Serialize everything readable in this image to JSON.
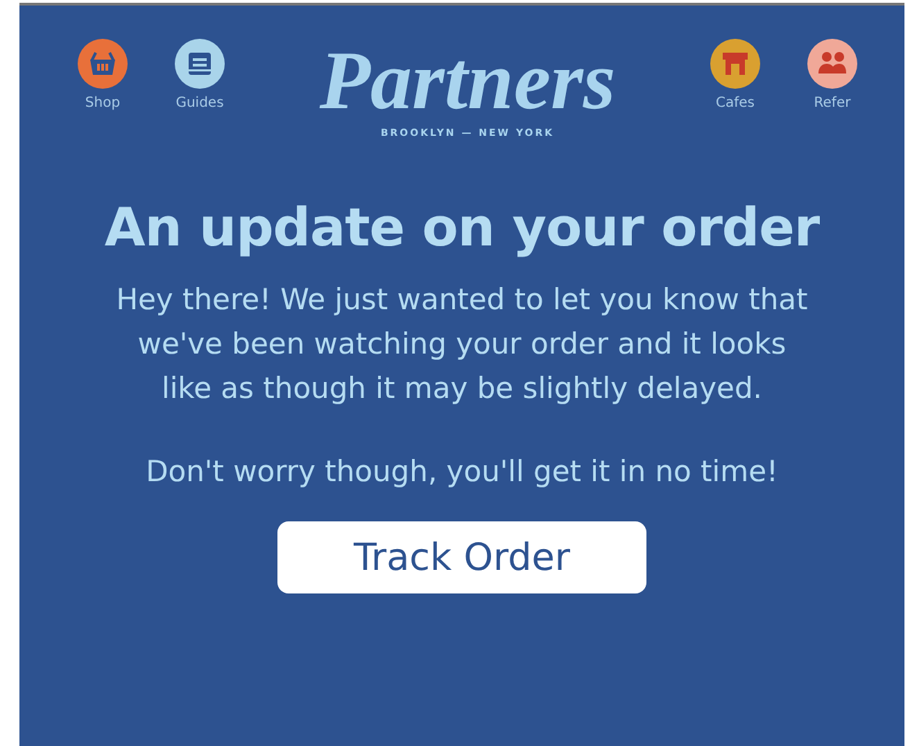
{
  "nav_left": [
    {
      "label": "Shop",
      "color": "#e8703a"
    },
    {
      "label": "Guides",
      "color": "#a9d4ea"
    }
  ],
  "logo": {
    "name": "Partners",
    "tagline": "BROOKLYN — NEW YORK"
  },
  "nav_right": [
    {
      "label": "Cafes",
      "color": "#d9a030"
    },
    {
      "label": "Refer",
      "color": "#f0a898"
    }
  ],
  "heading": "An update on your order",
  "paragraphs": [
    "Hey there! We just wanted to let you know that we've been watching your order and it looks like as though it may be slightly delayed.",
    "Don't worry though, you'll get it in no time!"
  ],
  "button": "Track Order"
}
